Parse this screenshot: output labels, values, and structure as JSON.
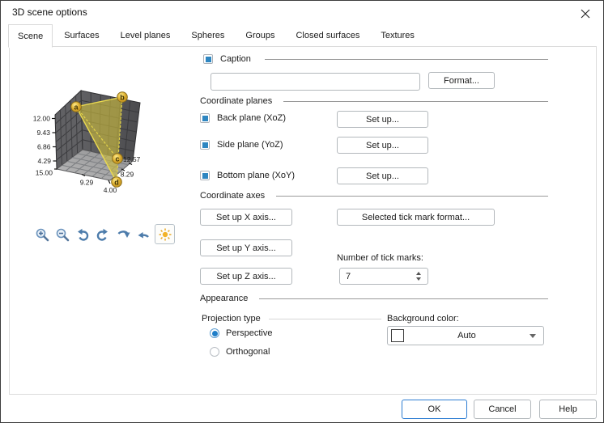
{
  "window": {
    "title": "3D scene options"
  },
  "tabs": [
    {
      "label": "Scene",
      "active": true
    },
    {
      "label": "Surfaces",
      "active": false
    },
    {
      "label": "Level planes",
      "active": false
    },
    {
      "label": "Spheres",
      "active": false
    },
    {
      "label": "Groups",
      "active": false
    },
    {
      "label": "Closed surfaces",
      "active": false
    },
    {
      "label": "Textures",
      "active": false
    }
  ],
  "preview": {
    "z_axis_ticks": [
      "12.00",
      "9.43",
      "6.86",
      "4.29"
    ],
    "corner_label": "15.00",
    "x_axis_tick": "9.29",
    "front_label": "4.00",
    "right_tick": "8.29",
    "right_tick2": "12.57",
    "vertex_labels": [
      "a",
      "b",
      "c",
      "d"
    ]
  },
  "view_toolbar": {
    "icons": [
      "zoom-in",
      "zoom-out",
      "rotate-left",
      "rotate-right",
      "rotate-forward",
      "rotate-backward",
      "lighting"
    ],
    "lighting_selected": true
  },
  "caption": {
    "label": "Caption",
    "checked": true,
    "value": "",
    "format_button": "Format..."
  },
  "coordinate_planes": {
    "title": "Coordinate planes",
    "items": [
      {
        "label": "Back plane (XoZ)",
        "checked": true,
        "button": "Set up..."
      },
      {
        "label": "Side plane (YoZ)",
        "checked": true,
        "button": "Set up..."
      },
      {
        "label": "Bottom plane (XoY)",
        "checked": true,
        "button": "Set up..."
      }
    ]
  },
  "coordinate_axes": {
    "title": "Coordinate axes",
    "setup_x": "Set up X axis...",
    "setup_y": "Set up Y axis...",
    "setup_z": "Set up Z axis...",
    "tick_format_button": "Selected tick mark format...",
    "tick_count_label": "Number of tick marks:",
    "tick_count": "7"
  },
  "appearance": {
    "title": "Appearance",
    "projection": {
      "label": "Projection type",
      "options": [
        {
          "label": "Perspective",
          "selected": true
        },
        {
          "label": "Orthogonal",
          "selected": false
        }
      ]
    },
    "background": {
      "label": "Background color:",
      "value": "Auto"
    }
  },
  "footer": {
    "ok": "OK",
    "cancel": "Cancel",
    "help": "Help"
  },
  "colors": {
    "accent_blue": "#2e86c1",
    "ok_border": "#2d7dd2",
    "surface_yellow": "#cdbd3e",
    "vertex_gold": "#e8c043",
    "wall_gray": "#5d5d60",
    "floor_gray": "#aaaaaa"
  }
}
